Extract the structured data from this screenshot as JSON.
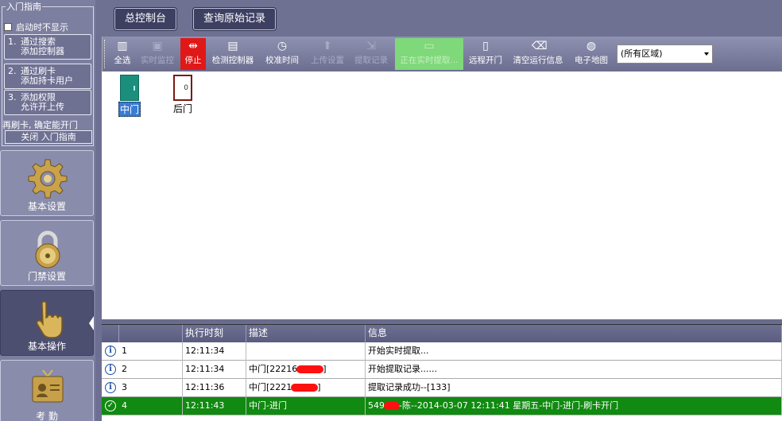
{
  "guide": {
    "title": "入门指南",
    "hide_on_start": "启动时不显示",
    "steps": [
      {
        "num": "1.",
        "line1": "通过搜索",
        "line2": "添加控制器"
      },
      {
        "num": "2.",
        "line1": "通过刷卡",
        "line2": "添加持卡用户"
      },
      {
        "num": "3.",
        "line1": "添加权限",
        "line2": "允许开上传"
      }
    ],
    "note": "再刷卡, 确定能开门",
    "close": "关闭 入门指南"
  },
  "nav": [
    {
      "label": "基本设置",
      "icon": "gear-icon"
    },
    {
      "label": "门禁设置",
      "icon": "lock-icon"
    },
    {
      "label": "基本操作",
      "icon": "hand-pointer-icon",
      "active": true
    },
    {
      "label": "考 勤",
      "icon": "id-card-icon"
    }
  ],
  "tabs": {
    "dashboard": "总控制台",
    "query_records": "查询原始记录"
  },
  "toolbar": {
    "select_all": "全选",
    "monitor": "实时监控",
    "stop": "停止",
    "check_controller": "检测控制器",
    "calibrate_time": "校准时间",
    "upload_settings": "上传设置",
    "download_records": "提取记录",
    "live_extract": "正在实时提取...",
    "remote_open": "远程开门",
    "clear_info": "清空运行信息",
    "e_map": "电子地图",
    "area": "(所有区域)"
  },
  "doors": [
    {
      "name": "中门",
      "selected": true,
      "color": "#1b8f7c"
    },
    {
      "name": "后门",
      "selected": false
    }
  ],
  "log": {
    "columns": [
      "",
      "",
      "执行时刻",
      "描述",
      "信息"
    ],
    "rows": [
      {
        "no": "1",
        "time": "12:11:34",
        "desc": "",
        "info": "开始实时提取...",
        "status": "info"
      },
      {
        "no": "2",
        "time": "12:11:34",
        "desc_prefix": "中门[22216",
        "desc_suffix": "]",
        "info": "开始提取记录......",
        "status": "info"
      },
      {
        "no": "3",
        "time": "12:11:36",
        "desc_prefix": "中门[2221",
        "desc_suffix": "]",
        "info": "提取记录成功--[133]",
        "status": "info"
      },
      {
        "no": "4",
        "time": "12:11:43",
        "desc": "中门-进门",
        "info_prefix": "549",
        "info_suffix": "-陈--2014-03-07 12:11:41 星期五-中门-进门-刷卡开门",
        "status": "success"
      }
    ]
  },
  "colors": {
    "sidebar": "#7d7fa0",
    "toolbar": "#7f81a3",
    "stop": "#e01818",
    "live": "#7fd879",
    "success_row": "#108a10",
    "selected_door": "#3a7cd4"
  }
}
